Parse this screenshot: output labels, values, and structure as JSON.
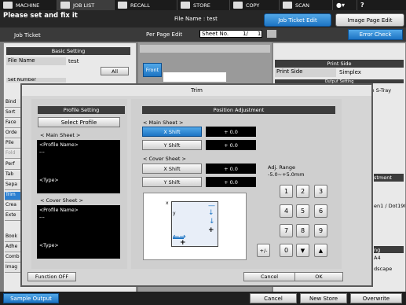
{
  "topbar": {
    "tabs": [
      {
        "label": "MACHINE",
        "icon": "machine-icon"
      },
      {
        "label": "JOB LIST",
        "icon": "list-icon"
      },
      {
        "label": "RECALL",
        "icon": "recall-icon"
      },
      {
        "label": "STORE",
        "icon": "store-icon"
      },
      {
        "label": "COPY",
        "icon": "copy-icon"
      },
      {
        "label": "SCAN",
        "icon": "scan-icon"
      }
    ]
  },
  "header": {
    "message": "Please set and fix it",
    "file_name_label": "File Name : test",
    "job_ticket_edit": "Job Ticket Edit",
    "image_page_edit": "Image Page Edit"
  },
  "subheader": {
    "job_ticket": "Job Ticket",
    "per_page_edit": "Per Page Edit",
    "sheet_no": "Sheet No.",
    "sheet_slash": "1/",
    "sheet_total": "1",
    "error_check": "Error Check"
  },
  "basic_setting": {
    "title": "Basic Setting",
    "file_name_label": "File Name",
    "file_name_value": "test",
    "all_button": "All",
    "set_number_label": "Set Number",
    "set_number_value": "0001"
  },
  "side_list": [
    "Bind",
    "Sort",
    "Face",
    "Orde",
    "Pile",
    "Fold",
    "Perf",
    "Tab",
    "Sepa",
    "Trim",
    "Crea",
    "Exte",
    "Book",
    "Adhe",
    "Comb",
    "Imag"
  ],
  "preview": {
    "front_tab": "Front"
  },
  "right_panel": {
    "print_side_title": "Print Side",
    "print_side_label": "Print Side",
    "print_side_value": "Simplex",
    "output_setting_partial": "Output Setting",
    "saddle_partial": "dleStitch S-Tray",
    "adjustment_partial": "stment",
    "paper_partial": "en1 / Dot190",
    "setting_partial": "ng",
    "a4_partial": "A4",
    "landscape_partial": "dscape"
  },
  "dialog": {
    "title": "Trim",
    "profile": {
      "title": "Profile Setting",
      "select_button": "Select Profile",
      "main_sheet_label": "< Main Sheet >",
      "main_profile_name": "<Profile Name>",
      "main_dashes": "---",
      "main_type": "<Type>",
      "cover_sheet_label": "< Cover Sheet >",
      "cover_profile_name": "<Profile Name>",
      "cover_dashes": "---",
      "cover_type": "<Type>"
    },
    "position": {
      "title": "Position Adjustment",
      "main_sheet_label": "< Main Sheet >",
      "main_x_shift": "X Shift",
      "main_x_value": "+ 0.0",
      "main_y_shift": "Y Shift",
      "main_y_value": "+ 0.0",
      "cover_sheet_label": "< Cover Sheet >",
      "cover_x_shift": "X Shift",
      "cover_x_value": "+ 0.0",
      "cover_y_shift": "Y Shift",
      "cover_y_value": "+ 0.0",
      "adj_range_label": "Adj. Range",
      "adj_range_value": "-5.0~+5.0mm",
      "diagram_x": "x",
      "diagram_y": "y",
      "keypad": [
        "1",
        "2",
        "3",
        "4",
        "5",
        "6",
        "7",
        "8",
        "9",
        "0"
      ],
      "plus_minus": "+/-"
    },
    "function_off": "Function OFF",
    "cancel": "Cancel",
    "ok": "OK"
  },
  "bottombar": {
    "sample_output": "Sample Output",
    "cancel": "Cancel",
    "new_store": "New Store",
    "overwrite": "Overwrite"
  }
}
